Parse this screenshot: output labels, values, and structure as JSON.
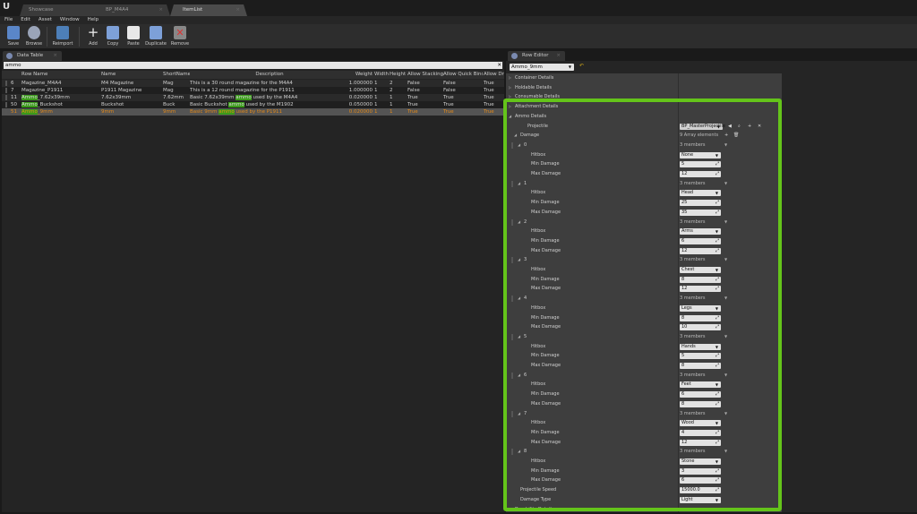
{
  "tabs": [
    {
      "label": "Showcase",
      "active": false
    },
    {
      "label": "BP_M4A4",
      "active": false
    },
    {
      "label": "ItemList",
      "active": true
    }
  ],
  "menu": [
    "File",
    "Edit",
    "Asset",
    "Window",
    "Help"
  ],
  "toolbar": [
    "Save",
    "Browse",
    "Reimport",
    "Add",
    "Copy",
    "Paste",
    "Duplicate",
    "Remove"
  ],
  "data_table": {
    "tab": "Data Table",
    "search": "ammo",
    "columns": [
      "Row Name",
      "Name",
      "ShortName",
      "Description",
      "Weight",
      "Width",
      "Height",
      "Allow Stacking",
      "Allow Quick Bind",
      "Allow Dro"
    ],
    "rows": [
      [
        "6",
        "Magazine_M4A4",
        "M4 Magazine",
        "Mag",
        "This is a 30 round magazine for the M4A4",
        "1.000000",
        "1",
        "2",
        "False",
        "False",
        "True"
      ],
      [
        "7",
        "Magazine_P1911",
        "P1911 Magazine",
        "Mag",
        "This is a 12 round magazine for the P1911",
        "1.000000",
        "1",
        "2",
        "False",
        "False",
        "True"
      ],
      [
        "11",
        "Ammo_7.62x39mm",
        "7.62x39mm",
        "7.62mm",
        "Basic 7.62x39mm ammo used by the M4A4",
        "0.020000",
        "1",
        "1",
        "True",
        "True",
        "True"
      ],
      [
        "50",
        "Ammo_Buckshot",
        "Buckshot",
        "Buck",
        "Basic Buckshot ammo used by the M1902",
        "0.050000",
        "1",
        "1",
        "True",
        "True",
        "True"
      ],
      [
        "51",
        "Ammo_9mm",
        "9mm",
        "9mm",
        "Basic 9mm ammo used by the P1911",
        "0.020000",
        "1",
        "1",
        "True",
        "True",
        "True"
      ]
    ],
    "selected_row": "51"
  },
  "row_editor": {
    "tab": "Row Editor",
    "row": "Ammo_9mm",
    "sections": [
      "Container Details",
      "Holdable Details",
      "Consumable Details",
      "Attachment Details",
      "Ammo Details"
    ],
    "projectile_label": "Projectile",
    "projectile": "BP_MasterProjectile",
    "damage_label": "Damage",
    "damage_count": "9 Array elements",
    "members": "3 members",
    "field_labels": {
      "hitbox": "Hitbox",
      "min": "Min Damage",
      "max": "Max Damage"
    },
    "damage": [
      {
        "index": "0",
        "hitbox": "None",
        "min": "5",
        "max": "12"
      },
      {
        "index": "1",
        "hitbox": "Head",
        "min": "25",
        "max": "35"
      },
      {
        "index": "2",
        "hitbox": "Arms",
        "min": "6",
        "max": "12"
      },
      {
        "index": "3",
        "hitbox": "Chest",
        "min": "8",
        "max": "12"
      },
      {
        "index": "4",
        "hitbox": "Legs",
        "min": "8",
        "max": "10"
      },
      {
        "index": "5",
        "hitbox": "Hands",
        "min": "5",
        "max": "8"
      },
      {
        "index": "6",
        "hitbox": "Feet",
        "min": "6",
        "max": "8"
      },
      {
        "index": "7",
        "hitbox": "Wood",
        "min": "4",
        "max": "12"
      },
      {
        "index": "8",
        "hitbox": "Stone",
        "min": "3",
        "max": "6"
      }
    ],
    "speed_label": "Projectile Speed",
    "speed": "15000.0",
    "damage_type_label": "Damage Type",
    "damage_type": "Light",
    "footer_section": "Durability Details"
  },
  "colors": {
    "highlight": "#64c41a",
    "selected_text": "#e38a1a"
  }
}
